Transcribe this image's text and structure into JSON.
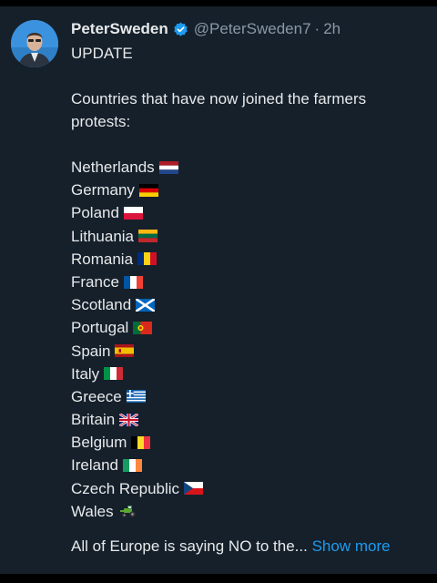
{
  "author": {
    "name": "PeterSweden",
    "handle": "@PeterSweden7",
    "separator": "·",
    "time": "2h",
    "verified": true,
    "avatar_icon": "profile-photo"
  },
  "tweet": {
    "heading": "UPDATE",
    "intro": "Countries that have now joined the farmers protests:",
    "countries": [
      {
        "name": "Netherlands",
        "flag": "flag-netherlands"
      },
      {
        "name": "Germany",
        "flag": "flag-germany"
      },
      {
        "name": "Poland",
        "flag": "flag-poland"
      },
      {
        "name": "Lithuania",
        "flag": "flag-lithuania"
      },
      {
        "name": "Romania",
        "flag": "flag-romania"
      },
      {
        "name": "France",
        "flag": "flag-france"
      },
      {
        "name": "Scotland",
        "flag": "flag-scotland"
      },
      {
        "name": "Portugal",
        "flag": "flag-portugal"
      },
      {
        "name": "Spain",
        "flag": "flag-spain"
      },
      {
        "name": "Italy",
        "flag": "flag-italy"
      },
      {
        "name": "Greece",
        "flag": "flag-greece"
      },
      {
        "name": "Britain",
        "flag": "flag-britain"
      },
      {
        "name": "Belgium",
        "flag": "flag-belgium"
      },
      {
        "name": "Ireland",
        "flag": "flag-ireland"
      },
      {
        "name": "Czech Republic",
        "flag": "flag-czech"
      },
      {
        "name": "Wales",
        "flag": "tractor-emoji"
      }
    ],
    "closing": "All of Europe is saying NO to the...",
    "show_more": "Show more"
  },
  "colors": {
    "background": "#15202b",
    "text": "#e7e9ea",
    "secondary": "#8b98a5",
    "link": "#1d9bf0"
  }
}
